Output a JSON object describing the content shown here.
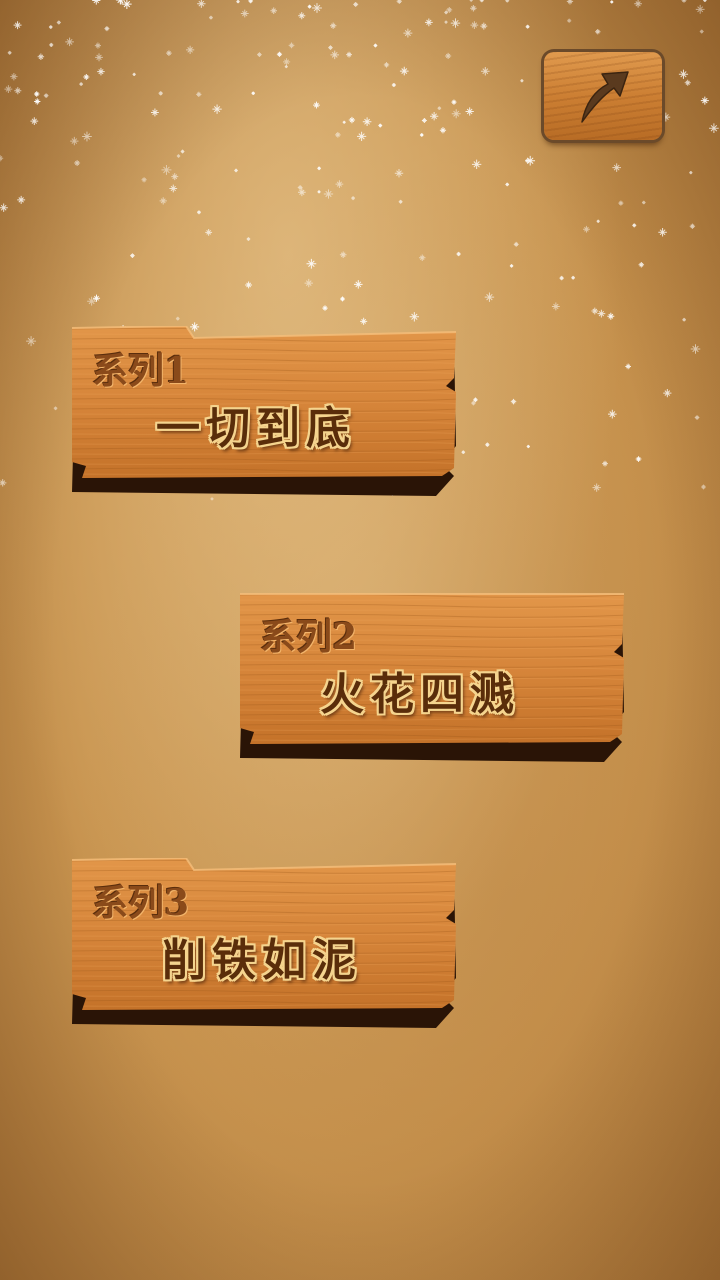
{
  "screen": "level-select",
  "colors": {
    "parchment": "#c99550",
    "plank": "#d98a3d",
    "plank_dark": "#7a4418",
    "title_fill": "#5a2d0a",
    "title_outline": "#f5d48e"
  },
  "back_button": {
    "icon": "back-arrow-icon"
  },
  "levels": [
    {
      "series_label": "系列1",
      "title": "一切到底"
    },
    {
      "series_label": "系列2",
      "title": "火花四溅"
    },
    {
      "series_label": "系列3",
      "title": "削铁如泥"
    }
  ]
}
